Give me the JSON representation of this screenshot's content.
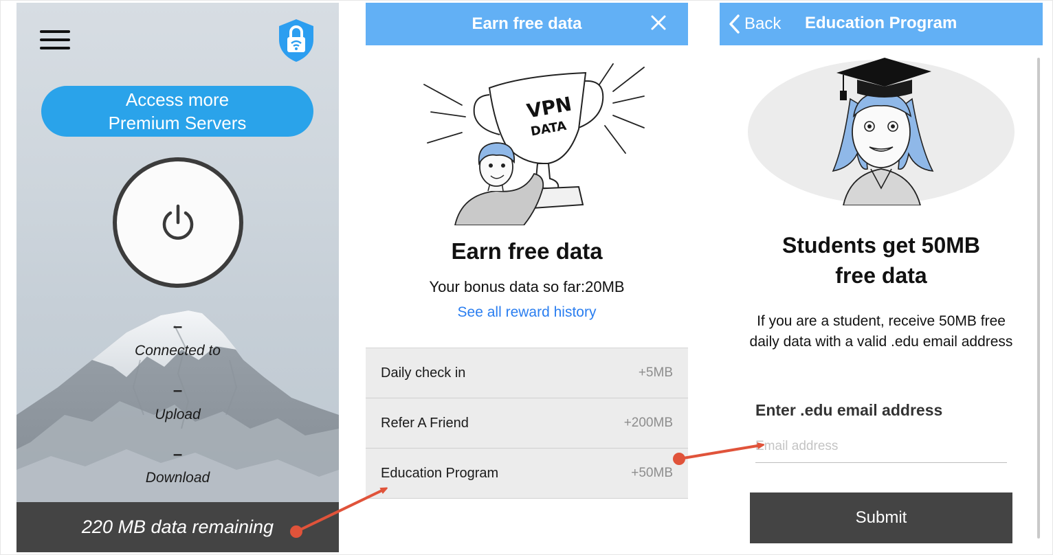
{
  "colors": {
    "header_blue": "#62b0f5",
    "premium_blue": "#2aa3ea",
    "dark_bar": "#444444",
    "link_blue": "#2a7ef0",
    "annotation_red": "#e0533a"
  },
  "home": {
    "menu_icon": "hamburger-menu-icon",
    "shield_icon": "vpn-shield-lock-icon",
    "premium_button": {
      "line1": "Access more",
      "line2": "Premium Servers"
    },
    "power_icon": "power-icon",
    "connected": {
      "value": "–",
      "label": "Connected to"
    },
    "upload": {
      "value": "–",
      "label": "Upload"
    },
    "download": {
      "value": "–",
      "label": "Download"
    },
    "data_remaining": "220 MB data remaining"
  },
  "earn": {
    "header_title": "Earn free data",
    "close_icon": "close-icon",
    "illustration_text": {
      "line1": "VPN",
      "line2": "DATA"
    },
    "title": "Earn free data",
    "bonus_text": "Your bonus data so far:20MB",
    "history_link": "See all reward history",
    "rewards": [
      {
        "name": "Daily check in",
        "amount": "+5MB"
      },
      {
        "name": "Refer A Friend",
        "amount": "+200MB"
      },
      {
        "name": "Education Program",
        "amount": "+50MB"
      }
    ]
  },
  "education": {
    "back_label": "Back",
    "header_title": "Education Program",
    "headline_line1": "Students get 50MB",
    "headline_line2": "free data",
    "description": "If you are a student, receive 50MB free daily data with a valid .edu email address",
    "field_label": "Enter .edu email address",
    "field_placeholder": "Email address",
    "field_value": "",
    "submit_label": "Submit"
  }
}
